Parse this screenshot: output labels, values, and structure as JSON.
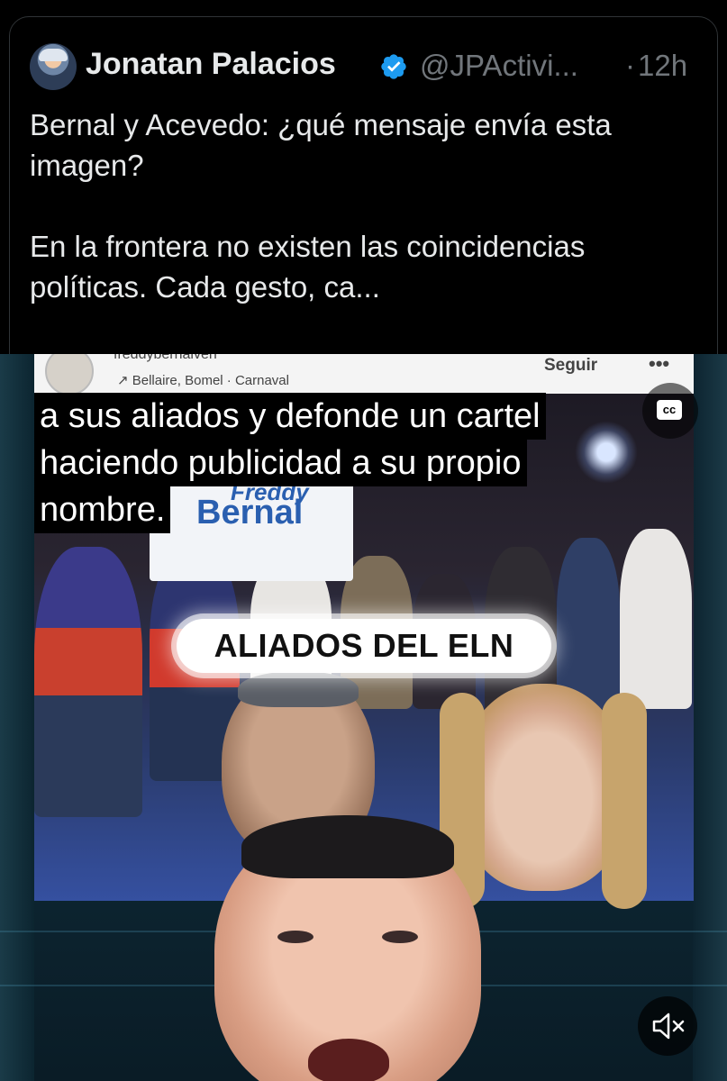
{
  "post": {
    "author_name": "Jonatan Palacios",
    "handle": "@JPActivi...",
    "separator": "·",
    "time": "12h",
    "text_paragraph_1": "Bernal y Acevedo: ¿qué mensaje envía esta imagen?",
    "text_paragraph_2": "En la frontera no existen las coincidencias políticas. Cada gesto, ca..."
  },
  "media": {
    "embedded_post": {
      "username": "freddybernalven",
      "location": "↗ Bellaire, Bomel · Carnaval",
      "follow_label": "Seguir",
      "more_label": "•••"
    },
    "poster": {
      "line1": "Freddy",
      "line2": "Bernal"
    },
    "caption_lines": [
      "a sus aliados y defonde un cartel",
      "haciendo publicidad a su propio",
      "nombre."
    ],
    "cc_label": "cc",
    "overlay_label": "ALIADOS DEL ELN"
  },
  "icons": {
    "verified": "verified-badge-icon",
    "captions": "closed-captions-icon",
    "mute": "volume-muted-icon"
  },
  "colors": {
    "background": "#000000",
    "text_primary": "#e7e9ea",
    "text_secondary": "#71767b",
    "verified_blue": "#1d9bf0"
  }
}
